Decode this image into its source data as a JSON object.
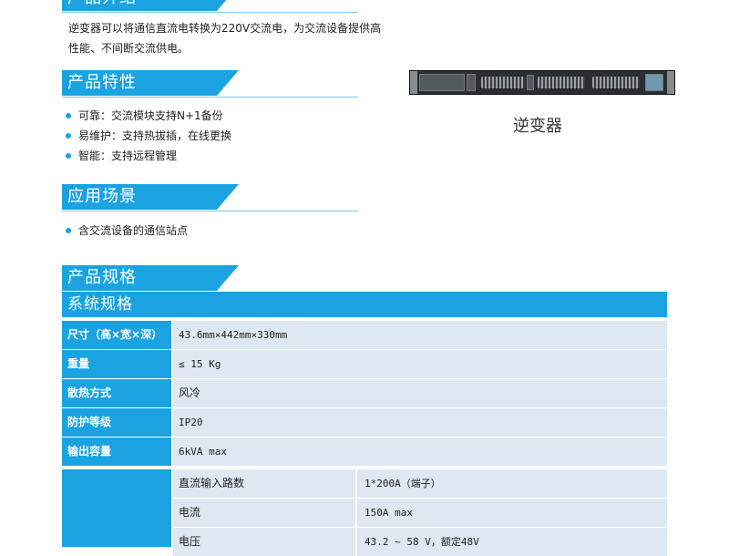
{
  "intro": {
    "header": "产品介绍",
    "text_line1": "逆变器可以将通信直流电转换为220V交流电，为交流设备提供高",
    "text_line2": "性能、不间断交流供电。"
  },
  "features": {
    "header": "产品特性",
    "items": [
      "可靠：交流模块支持N+1备份",
      "易维护：支持热拔插，在线更换",
      "智能：支持远程管理"
    ]
  },
  "applications": {
    "header": "应用场景",
    "items": [
      "含交流设备的通信站点"
    ]
  },
  "product_image": {
    "caption": "逆变器"
  },
  "specs": {
    "header": "产品规格",
    "table_title": "系统规格",
    "rows": [
      {
        "label": "尺寸（高×宽×深）",
        "value": "43.6mm×442mm×330mm"
      },
      {
        "label": "重量",
        "value": "≤ 15 Kg"
      },
      {
        "label": "散热方式",
        "value": "风冷"
      },
      {
        "label": "防护等级",
        "value": "IP20"
      },
      {
        "label": "输出容量",
        "value": "6kVA max"
      }
    ],
    "sub_rows": [
      {
        "key": "直流输入路数",
        "value": "1*200A（端子）"
      },
      {
        "key": "电流",
        "value": "150A max"
      },
      {
        "key": "电压",
        "value": "43.2 ~ 58 V，额定48V"
      }
    ]
  },
  "colors": {
    "accent": "#1aa3e0",
    "cell_bg": "#dde8f2"
  }
}
